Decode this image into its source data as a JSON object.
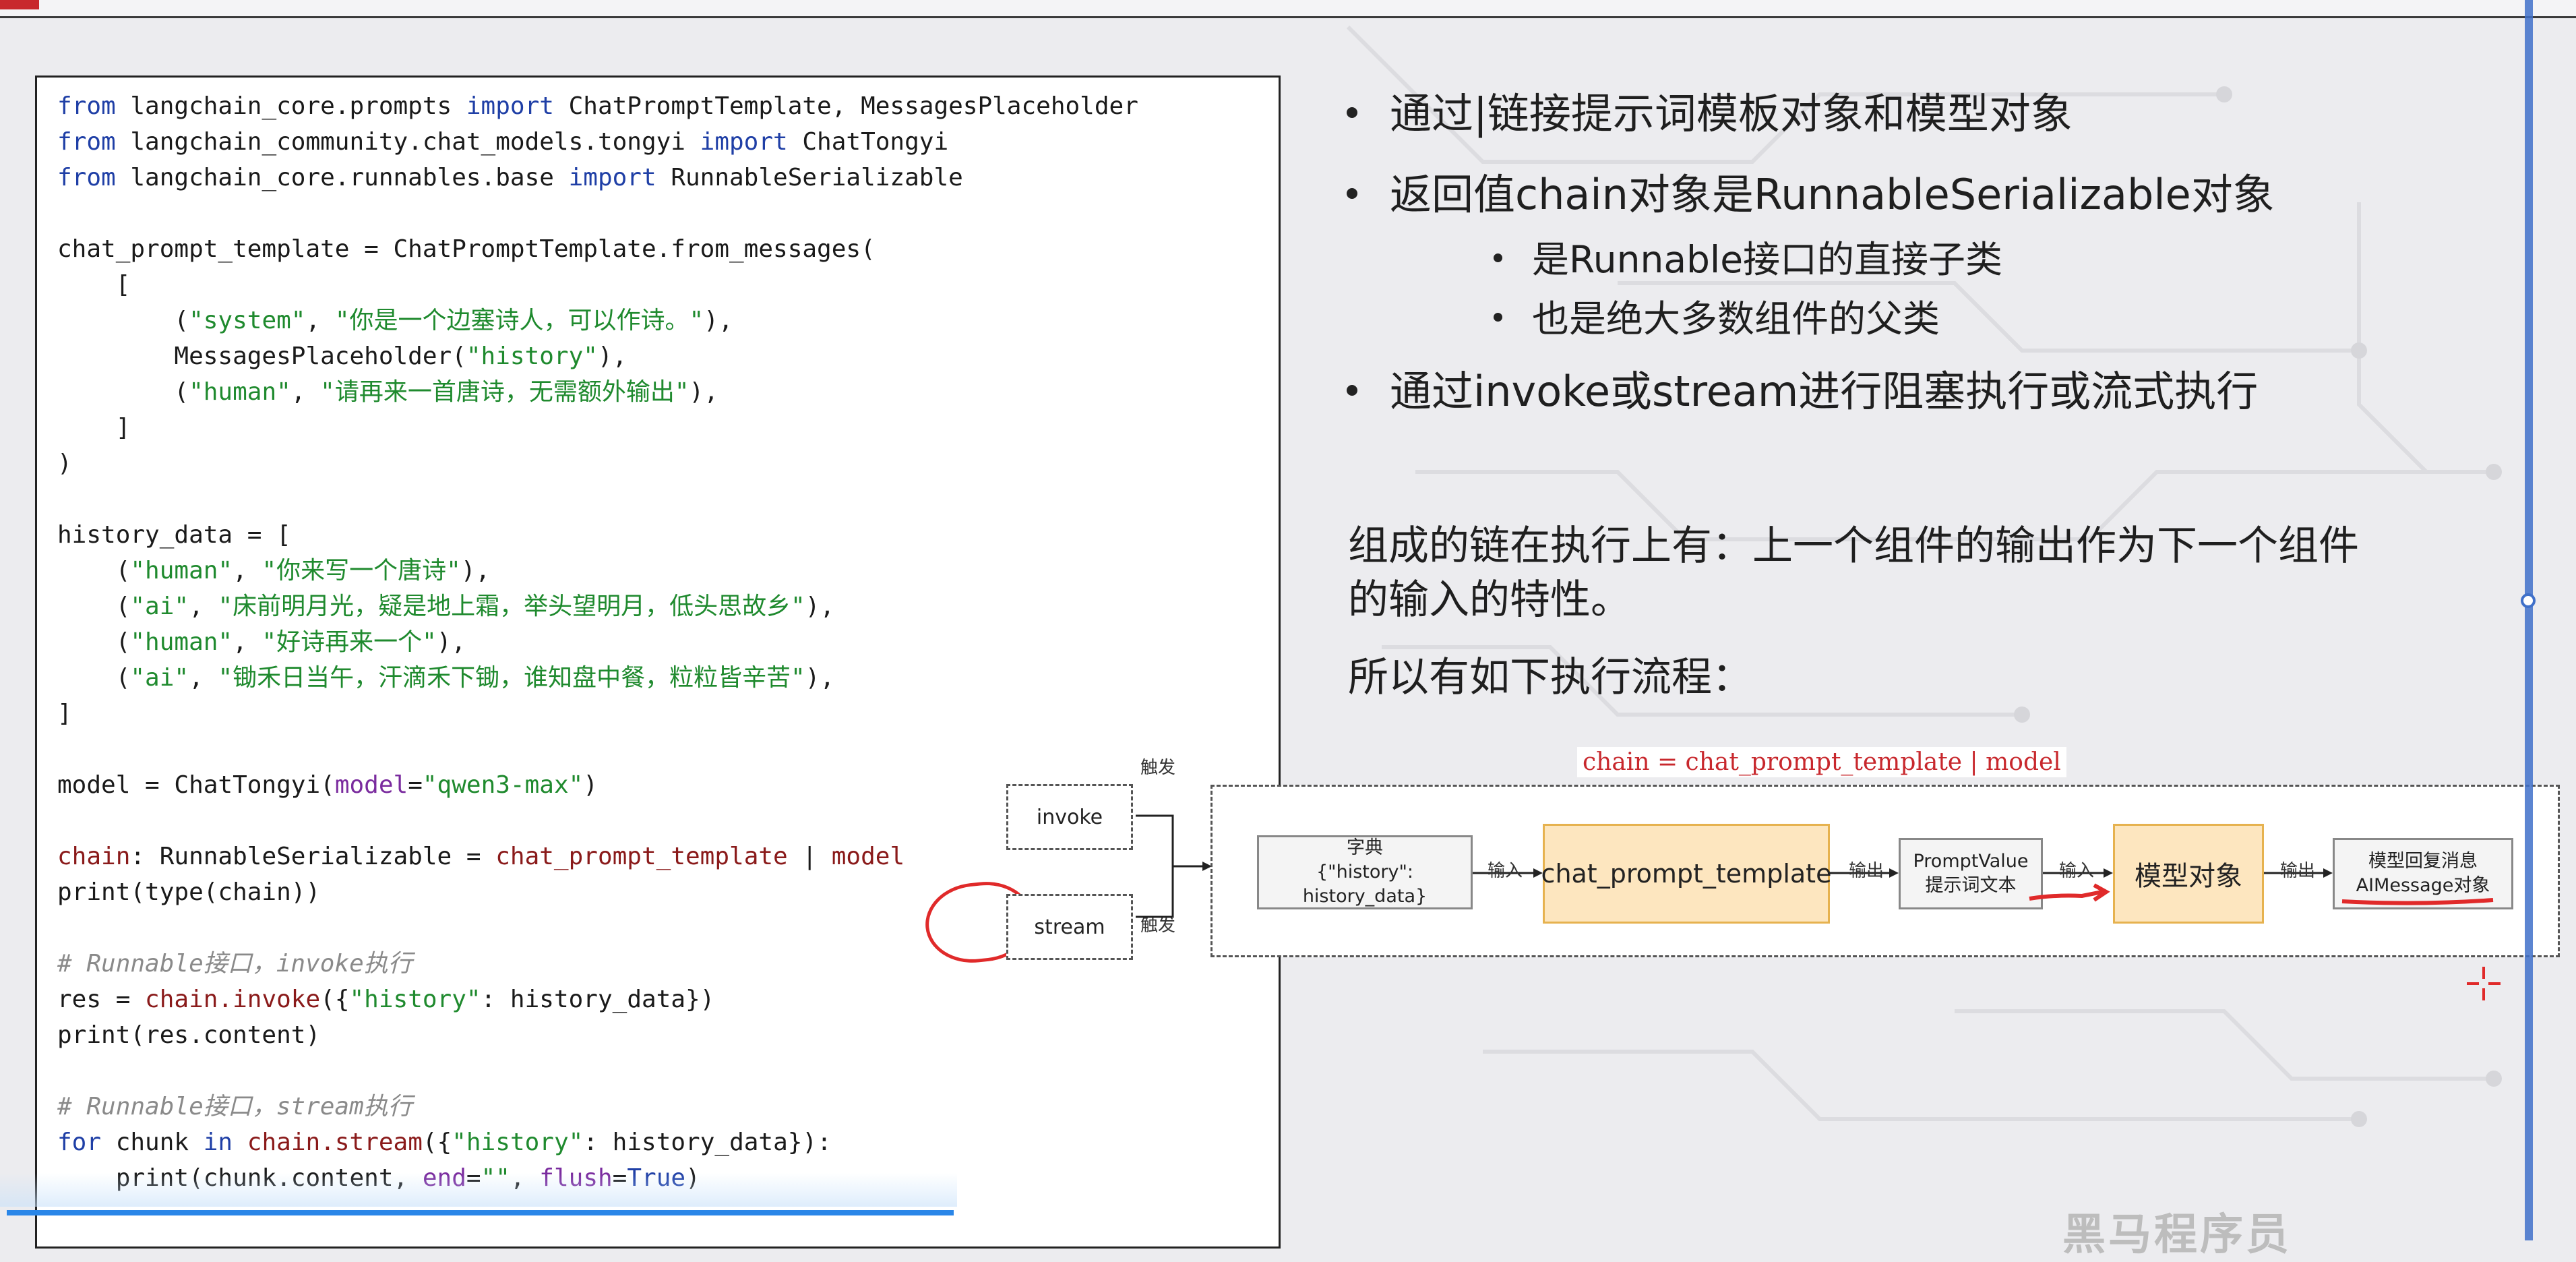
{
  "code": {
    "lines": [
      [
        {
          "c": "kw",
          "t": "from"
        },
        {
          "c": "",
          "t": " langchain_core.prompts "
        },
        {
          "c": "kw",
          "t": "import"
        },
        {
          "c": "",
          "t": " ChatPromptTemplate, MessagesPlaceholder"
        }
      ],
      [
        {
          "c": "kw",
          "t": "from"
        },
        {
          "c": "",
          "t": " langchain_community.chat_models.tongyi "
        },
        {
          "c": "kw",
          "t": "import"
        },
        {
          "c": "",
          "t": " ChatTongyi"
        }
      ],
      [
        {
          "c": "kw",
          "t": "from"
        },
        {
          "c": "",
          "t": " langchain_core.runnables.base "
        },
        {
          "c": "kw",
          "t": "import"
        },
        {
          "c": "",
          "t": " RunnableSerializable"
        }
      ],
      [],
      [
        {
          "c": "",
          "t": "chat_prompt_template = ChatPromptTemplate.from_messages("
        }
      ],
      [
        {
          "c": "",
          "t": "    ["
        }
      ],
      [
        {
          "c": "",
          "t": "        ("
        },
        {
          "c": "str",
          "t": "\"system\""
        },
        {
          "c": "",
          "t": ", "
        },
        {
          "c": "str",
          "t": "\"你是一个边塞诗人，可以作诗。\""
        },
        {
          "c": "",
          "t": "),"
        }
      ],
      [
        {
          "c": "",
          "t": "        MessagesPlaceholder("
        },
        {
          "c": "str",
          "t": "\"history\""
        },
        {
          "c": "",
          "t": "),"
        }
      ],
      [
        {
          "c": "",
          "t": "        ("
        },
        {
          "c": "str",
          "t": "\"human\""
        },
        {
          "c": "",
          "t": ", "
        },
        {
          "c": "str",
          "t": "\"请再来一首唐诗，无需额外输出\""
        },
        {
          "c": "",
          "t": "),"
        }
      ],
      [
        {
          "c": "",
          "t": "    ]"
        }
      ],
      [
        {
          "c": "",
          "t": ")"
        }
      ],
      [],
      [
        {
          "c": "",
          "t": "history_data = ["
        }
      ],
      [
        {
          "c": "",
          "t": "    ("
        },
        {
          "c": "str",
          "t": "\"human\""
        },
        {
          "c": "",
          "t": ", "
        },
        {
          "c": "str",
          "t": "\"你来写一个唐诗\""
        },
        {
          "c": "",
          "t": "),"
        }
      ],
      [
        {
          "c": "",
          "t": "    ("
        },
        {
          "c": "str",
          "t": "\"ai\""
        },
        {
          "c": "",
          "t": ", "
        },
        {
          "c": "str",
          "t": "\"床前明月光，疑是地上霜，举头望明月，低头思故乡\""
        },
        {
          "c": "",
          "t": "),"
        }
      ],
      [
        {
          "c": "",
          "t": "    ("
        },
        {
          "c": "str",
          "t": "\"human\""
        },
        {
          "c": "",
          "t": ", "
        },
        {
          "c": "str",
          "t": "\"好诗再来一个\""
        },
        {
          "c": "",
          "t": "),"
        }
      ],
      [
        {
          "c": "",
          "t": "    ("
        },
        {
          "c": "str",
          "t": "\"ai\""
        },
        {
          "c": "",
          "t": ", "
        },
        {
          "c": "str",
          "t": "\"锄禾日当午，汗滴禾下锄，谁知盘中餐，粒粒皆辛苦\""
        },
        {
          "c": "",
          "t": "),"
        }
      ],
      [
        {
          "c": "",
          "t": "]"
        }
      ],
      [],
      [
        {
          "c": "",
          "t": "model = ChatTongyi("
        },
        {
          "c": "prm",
          "t": "model"
        },
        {
          "c": "",
          "t": "="
        },
        {
          "c": "str",
          "t": "\"qwen3-max\""
        },
        {
          "c": "",
          "t": ")"
        }
      ],
      [],
      [
        {
          "c": "var",
          "t": "chain"
        },
        {
          "c": "",
          "t": ": RunnableSerializable = "
        },
        {
          "c": "var",
          "t": "chat_prompt_template"
        },
        {
          "c": "",
          "t": " | "
        },
        {
          "c": "var",
          "t": "model"
        }
      ],
      [
        {
          "c": "",
          "t": "print(type(chain))"
        }
      ],
      [],
      [
        {
          "c": "cmt",
          "t": "# Runnable接口，invoke执行"
        }
      ],
      [
        {
          "c": "",
          "t": "res = "
        },
        {
          "c": "var",
          "t": "chain.invoke"
        },
        {
          "c": "",
          "t": "({"
        },
        {
          "c": "str",
          "t": "\"history\""
        },
        {
          "c": "",
          "t": ": history_data})"
        }
      ],
      [
        {
          "c": "",
          "t": "print(res.content)"
        }
      ],
      [],
      [
        {
          "c": "cmt",
          "t": "# Runnable接口，stream执行"
        }
      ],
      [
        {
          "c": "kw",
          "t": "for"
        },
        {
          "c": "",
          "t": " chunk "
        },
        {
          "c": "kw",
          "t": "in"
        },
        {
          "c": "",
          "t": " "
        },
        {
          "c": "var",
          "t": "chain.stream"
        },
        {
          "c": "",
          "t": "({"
        },
        {
          "c": "str",
          "t": "\"history\""
        },
        {
          "c": "",
          "t": ": history_data}):"
        }
      ],
      [
        {
          "c": "",
          "t": "    print(chunk.content, "
        },
        {
          "c": "prm",
          "t": "end"
        },
        {
          "c": "",
          "t": "="
        },
        {
          "c": "str",
          "t": "\"\""
        },
        {
          "c": "",
          "t": ", "
        },
        {
          "c": "prm",
          "t": "flush"
        },
        {
          "c": "",
          "t": "="
        },
        {
          "c": "kw",
          "t": "True"
        },
        {
          "c": "",
          "t": ")"
        }
      ]
    ]
  },
  "bullets": {
    "b1": "通过|链接提示词模板对象和模型对象",
    "b2": "返回值chain对象是RunnableSerializable对象",
    "b2_sub1": "是Runnable接口的直接子类",
    "b2_sub2": "也是绝大多数组件的父类",
    "b3": "通过invoke或stream进行阻塞执行或流式执行"
  },
  "paragraphs": {
    "p1_line1": "组成的链在执行上有：上一个组件的输出作为下一个组件",
    "p1_line2": "的输入的特性。",
    "p2": "所以有如下执行流程："
  },
  "diagram": {
    "caption": "chain = chat_prompt_template | model",
    "invoke": "invoke",
    "stream": "stream",
    "trigger_label": "触发",
    "dict_line1": "字典",
    "dict_line2": "{\"history\": history_data}",
    "input_label": "输入",
    "output_label": "输出",
    "prompt_node": "chat_prompt_template",
    "pv_line1": "PromptValue",
    "pv_line2": "提示词文本",
    "model_node": "模型对象",
    "reply_line1": "模型回复消息",
    "reply_line2": "AIMessage对象"
  },
  "watermark": "黑马程序员",
  "colors": {
    "accent_red": "#c8282d",
    "keyword_blue": "#1f3fa6",
    "string_green": "#1f8a2e",
    "node_orange": "#fde6bf",
    "scrollbar_blue": "#2a86e8"
  }
}
